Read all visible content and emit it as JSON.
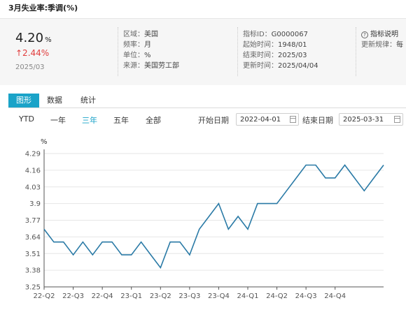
{
  "page": {
    "title": "3月失业率:季调(%)"
  },
  "summary": {
    "value": "4.20",
    "unit": "%",
    "change": "↑2.44%",
    "date": "2025/03",
    "meta1": [
      {
        "k": "区域：",
        "v": "美国"
      },
      {
        "k": "频率：",
        "v": "月"
      },
      {
        "k": "单位：",
        "v": "%"
      },
      {
        "k": "来源：",
        "v": "美国劳工部"
      }
    ],
    "meta2": [
      {
        "k": "指标ID：",
        "v": "G0000067"
      },
      {
        "k": "起始时间：",
        "v": "1948/01"
      },
      {
        "k": "结束时间：",
        "v": "2025/03"
      },
      {
        "k": "更新时间：",
        "v": "2025/04/04"
      }
    ],
    "meta3": [
      {
        "k": "",
        "v": "指标说明"
      },
      {
        "k": "更新规律：",
        "v": "每"
      }
    ]
  },
  "tabs": [
    "图形",
    "数据",
    "统计"
  ],
  "ranges": [
    "YTD",
    "一年",
    "三年",
    "五年",
    "全部"
  ],
  "dates": {
    "start_label": "开始日期",
    "start_value": "2022-04-01",
    "end_label": "结束日期",
    "end_value": "2025-03-31"
  },
  "chart_data": {
    "type": "line",
    "ylabel": "%",
    "ylim": [
      3.25,
      4.29
    ],
    "yticks": [
      "3.25",
      "3.38",
      "3.51",
      "3.64",
      "3.77",
      "3.9",
      "4.03",
      "4.16",
      "4.29"
    ],
    "grid": true,
    "xticks": [
      "22-Q2",
      "22-Q3",
      "22-Q4",
      "23-Q1",
      "23-Q2",
      "23-Q3",
      "23-Q4",
      "24-Q1",
      "24-Q2",
      "24-Q3",
      "24-Q4"
    ],
    "x": [
      "2022-04",
      "2022-05",
      "2022-06",
      "2022-07",
      "2022-08",
      "2022-09",
      "2022-10",
      "2022-11",
      "2022-12",
      "2023-01",
      "2023-02",
      "2023-03",
      "2023-04",
      "2023-05",
      "2023-06",
      "2023-07",
      "2023-08",
      "2023-09",
      "2023-10",
      "2023-11",
      "2023-12",
      "2024-01",
      "2024-02",
      "2024-03",
      "2024-04",
      "2024-05",
      "2024-06",
      "2024-07",
      "2024-08",
      "2024-09",
      "2024-10",
      "2024-11",
      "2024-12",
      "2025-01",
      "2025-02",
      "2025-03"
    ],
    "values": [
      3.7,
      3.6,
      3.6,
      3.5,
      3.6,
      3.5,
      3.6,
      3.6,
      3.5,
      3.5,
      3.6,
      3.5,
      3.4,
      3.6,
      3.6,
      3.5,
      3.7,
      3.8,
      3.9,
      3.7,
      3.8,
      3.7,
      3.9,
      3.9,
      3.9,
      4.0,
      4.1,
      4.2,
      4.2,
      4.1,
      4.1,
      4.2,
      4.1,
      4.0,
      4.1,
      4.2
    ]
  },
  "colors": {
    "accent": "#1aa3c8",
    "line": "#2a7aa6",
    "up": "#e03c3c"
  }
}
